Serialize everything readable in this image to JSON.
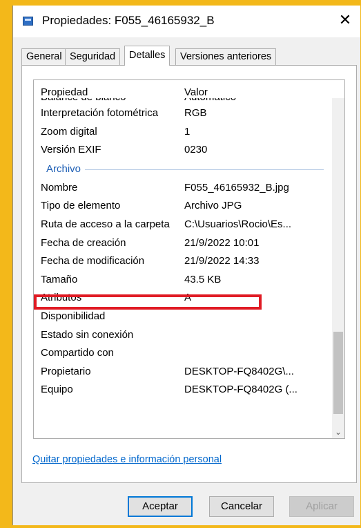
{
  "window": {
    "title": "Propiedades: F055_46165932_B",
    "close_glyph": "✕"
  },
  "tabs": [
    {
      "label": "General",
      "active": false
    },
    {
      "label": "Seguridad",
      "active": false
    },
    {
      "label": "Detalles",
      "active": true
    },
    {
      "label": "Versiones anteriores",
      "active": false
    }
  ],
  "details": {
    "header": {
      "property": "Propiedad",
      "value": "Valor"
    },
    "cut_row": {
      "property": "Balance de blanco",
      "value": "Automático"
    },
    "rows_top": [
      {
        "property": "Interpretación fotométrica",
        "value": "RGB"
      },
      {
        "property": "Zoom digital",
        "value": "1"
      },
      {
        "property": "Versión EXIF",
        "value": "0230"
      }
    ],
    "group_label": "Archivo",
    "rows_file": [
      {
        "property": "Nombre",
        "value": "F055_46165932_B.jpg"
      },
      {
        "property": "Tipo de elemento",
        "value": "Archivo JPG"
      },
      {
        "property": "Ruta de acceso a la carpeta",
        "value": "C:\\Usuarios\\Rocio\\Es..."
      },
      {
        "property": "Fecha de creación",
        "value": "21/9/2022 10:01"
      },
      {
        "property": "Fecha de modificación",
        "value": "21/9/2022 14:33"
      },
      {
        "property": "Tamaño",
        "value": "43.5 KB"
      },
      {
        "property": "Atributos",
        "value": "A"
      },
      {
        "property": "Disponibilidad",
        "value": ""
      },
      {
        "property": "Estado sin conexión",
        "value": ""
      },
      {
        "property": "Compartido con",
        "value": ""
      },
      {
        "property": "Propietario",
        "value": "DESKTOP-FQ8402G\\..."
      },
      {
        "property": "Equipo",
        "value": "DESKTOP-FQ8402G (..."
      }
    ],
    "highlighted_property": "Tamaño",
    "scroll_up_glyph": "⌃",
    "scroll_down_glyph": "⌄"
  },
  "remove_properties_link": "Quitar propiedades e información personal",
  "buttons": {
    "ok": "Aceptar",
    "cancel": "Cancelar",
    "apply": "Aplicar"
  },
  "colors": {
    "highlight": "#e01b24",
    "accent": "#0078d7",
    "background": "#f3b81a",
    "group": "#1e5fb5"
  }
}
